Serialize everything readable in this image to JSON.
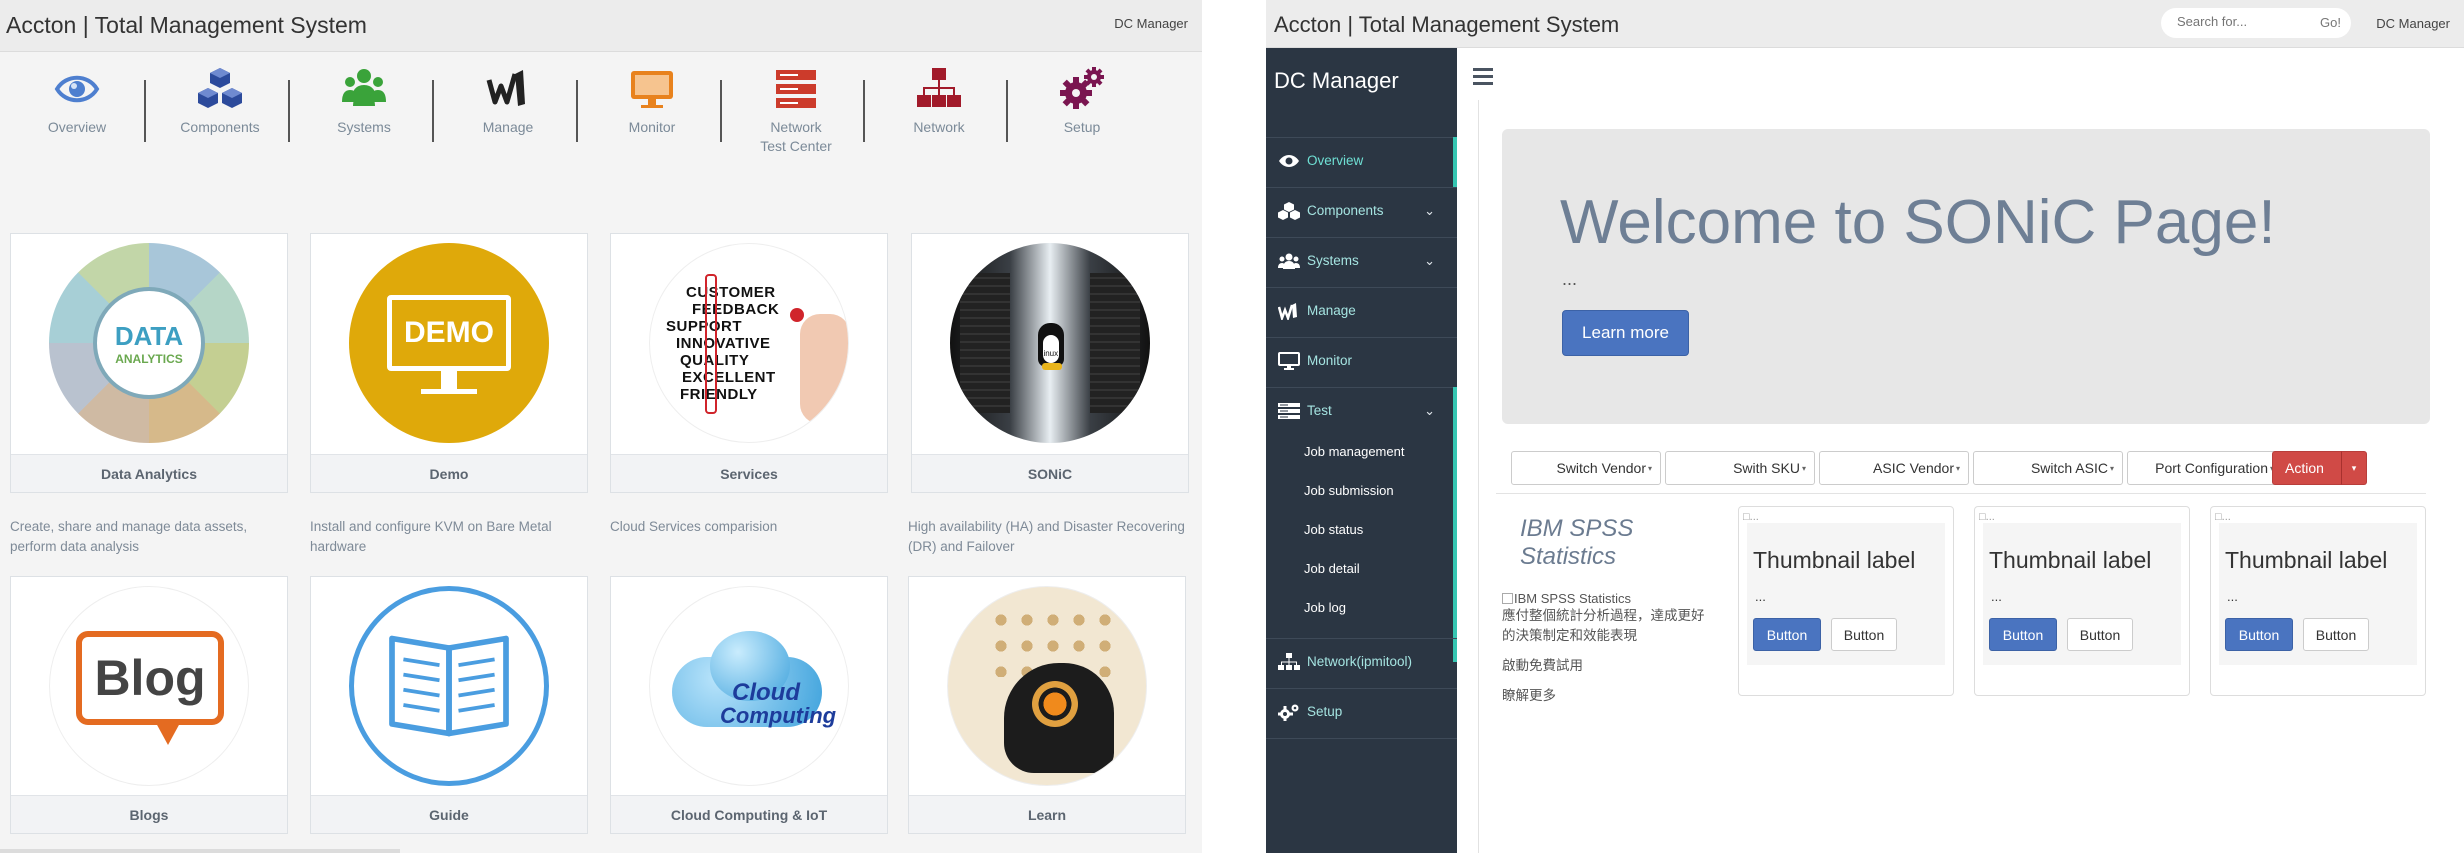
{
  "left_window": {
    "app_title": "Accton | Total Management System",
    "user_link": "DC Manager",
    "nav_items": [
      {
        "label": "Overview",
        "icon": "eye-icon",
        "color": "#4e7fcf"
      },
      {
        "label": "Components",
        "icon": "cubes-icon",
        "color": "#2c4a9b"
      },
      {
        "label": "Systems",
        "icon": "users-icon",
        "color": "#3aa33a"
      },
      {
        "label": "Manage",
        "icon": "manage-logo-icon",
        "color": "#222222"
      },
      {
        "label": "Monitor",
        "icon": "monitor-icon",
        "color": "#e8821d"
      },
      {
        "label": "Network",
        "label2": "Test Center",
        "icon": "server-list-icon",
        "color": "#cc3b2b"
      },
      {
        "label": "Network",
        "icon": "sitemap-icon",
        "color": "#a11a2a"
      },
      {
        "label": "Setup",
        "icon": "gears-icon",
        "color": "#7a1550"
      }
    ],
    "cards": [
      {
        "title": "Data Analytics",
        "description": "Create, share and manage data assets, perform data analysis",
        "image": "data-analytics-wheel",
        "image_text": "DATA",
        "image_text2": "ANALYTICS"
      },
      {
        "title": "Demo",
        "description": "Install and configure KVM on Bare Metal hardware",
        "image": "demo-monitor",
        "image_text": "DEMO"
      },
      {
        "title": "Services",
        "description": "Cloud Services comparision",
        "image": "customer-feedback-words",
        "image_lines": [
          "CUSTOMER",
          "FEEDBACK",
          "SUPPORT",
          "INNOVATIVE",
          "QUALITY",
          "EXCELLENT",
          "FRIENDLY"
        ]
      },
      {
        "title": "SONiC",
        "description": "High availability (HA) and Disaster Recovering (DR) and Failover",
        "image": "datacenter-linux",
        "image_text": "Linux"
      },
      {
        "title": "Blogs",
        "image": "blog-bubble",
        "image_text": "Blog"
      },
      {
        "title": "Guide",
        "image": "open-book"
      },
      {
        "title": "Cloud Computing & IoT",
        "image": "cloud-computing",
        "image_text": "Cloud",
        "image_text2": "Computing"
      },
      {
        "title": "Learn",
        "image": "head-gears"
      }
    ]
  },
  "right_window": {
    "app_title": "Accton | Total Management System",
    "search": {
      "placeholder": "Search for...",
      "button": "Go!"
    },
    "user_link": "DC Manager",
    "sidebar": {
      "brand": "DC Manager",
      "items": [
        {
          "label": "Overview",
          "icon": "eye-icon",
          "active": true
        },
        {
          "label": "Components",
          "icon": "cubes-icon",
          "has_submenu": true
        },
        {
          "label": "Systems",
          "icon": "users-icon",
          "has_submenu": true
        },
        {
          "label": "Manage",
          "icon": "manage-logo-icon"
        },
        {
          "label": "Monitor",
          "icon": "monitor-icon"
        },
        {
          "label": "Test",
          "icon": "list-icon",
          "has_submenu": true,
          "expanded": true
        },
        {
          "label": "Network(ipmitool)",
          "icon": "sitemap-icon"
        },
        {
          "label": "Setup",
          "icon": "gears-icon"
        }
      ],
      "test_submenu": [
        "Job management",
        "Job submission",
        "Job status",
        "Job detail",
        "Job log"
      ]
    },
    "jumbotron": {
      "heading": "Welcome to SONiC Page!",
      "text": "...",
      "button": "Learn more"
    },
    "toolbar": {
      "dropdowns": [
        "Switch Vendor",
        "Swith SKU",
        "ASIC Vendor",
        "Switch ASIC",
        "Port Configuration"
      ],
      "action": "Action"
    },
    "spss": {
      "title": "IBM SPSS Statistics",
      "image_alt": "IBM SPSS Statistics",
      "description": "應付整個統計分析過程，達成更好的決策制定和效能表現",
      "link1": "啟動免費試用",
      "link2": "瞭解更多"
    },
    "thumbnails": [
      {
        "label": "Thumbnail label",
        "text": "...",
        "primary_button": "Button",
        "default_button": "Button"
      },
      {
        "label": "Thumbnail label",
        "text": "...",
        "primary_button": "Button",
        "default_button": "Button"
      },
      {
        "label": "Thumbnail label",
        "text": "...",
        "primary_button": "Button",
        "default_button": "Button"
      }
    ]
  },
  "colors": {
    "sidebar_bg": "#2b3643",
    "sidebar_accent": "#36c6b2",
    "primary_button": "#4a74c0",
    "danger_button": "#d04a46"
  }
}
